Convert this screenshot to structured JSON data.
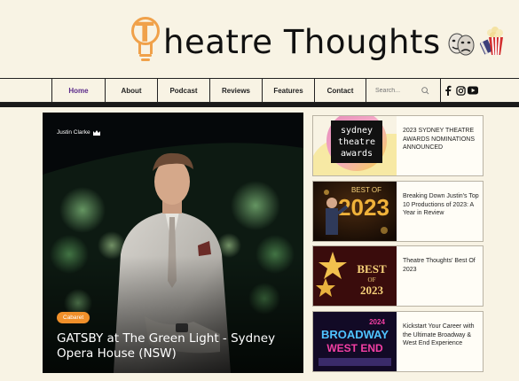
{
  "site": {
    "logo_text": "heatre Thoughts",
    "logo_letter": "T"
  },
  "nav": {
    "items": [
      {
        "label": "Home",
        "active": true
      },
      {
        "label": "About"
      },
      {
        "label": "Podcast"
      },
      {
        "label": "Reviews"
      },
      {
        "label": "Features"
      },
      {
        "label": "Contact"
      }
    ],
    "search_placeholder": "Search...",
    "social_icons": [
      "facebook-icon",
      "instagram-icon",
      "youtube-icon"
    ]
  },
  "hero": {
    "author": "Justin Clarke",
    "tag": "Cabaret",
    "title": "GATSBY at The Green Light - Sydney Opera House (NSW)"
  },
  "articles": [
    {
      "title": "2023 SYDNEY THEATRE AWARDS NOMINATIONS ANNOUNCED",
      "thumb_lines": [
        "sydney",
        "theatre",
        "awards"
      ]
    },
    {
      "title": "Breaking Down Justin's Top 10 Productions of 2023: A Year in Review",
      "thumb_lines": [
        "BEST OF",
        "2023"
      ]
    },
    {
      "title": "Theatre Thoughts' Best Of 2023",
      "thumb_lines": [
        "BEST",
        "OF",
        "2023"
      ]
    },
    {
      "title": "Kickstart Your Career with the Ultimate Broadway & West End Experience",
      "thumb_lines": [
        "2024",
        "BROADWAY",
        "WEST END"
      ]
    }
  ],
  "colors": {
    "accent": "#f0a14a",
    "nav_active": "#5b2a8a",
    "background": "#f8f3e4"
  }
}
